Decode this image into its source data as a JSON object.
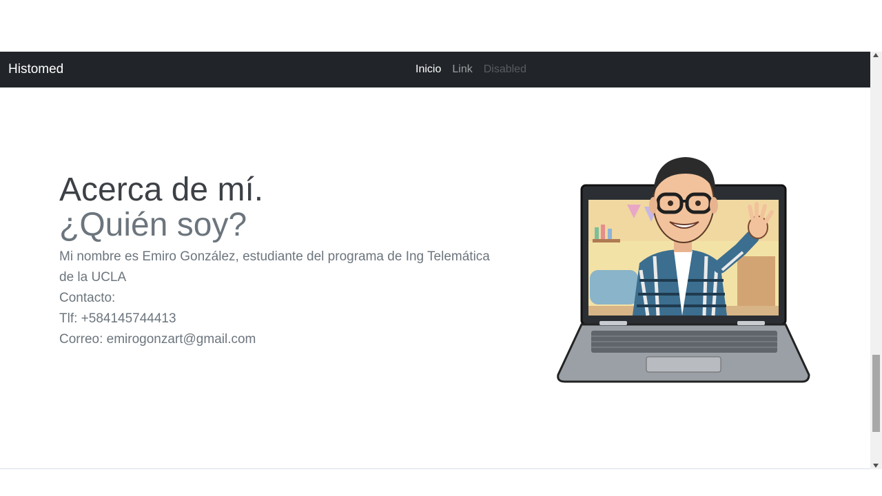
{
  "navbar": {
    "brand": "Histomed",
    "links": [
      {
        "label": "Inicio",
        "state": "active"
      },
      {
        "label": "Link",
        "state": "normal"
      },
      {
        "label": "Disabled",
        "state": "disabled"
      }
    ]
  },
  "about": {
    "heading": "Acerca de mí.",
    "subheading": "¿Quién soy?",
    "description": "Mi nombre es Emiro González, estudiante del programa de Ing Telemática de la UCLA",
    "contact_label": "Contacto:",
    "phone": "Tlf: +584145744413",
    "email": "Correo: emirogonzart@gmail.com"
  },
  "illustration": {
    "icon": "laptop-avatar-waving-icon"
  },
  "colors": {
    "navbar_bg": "#212529",
    "heading": "#3d4146",
    "muted_text": "#6c757d"
  }
}
